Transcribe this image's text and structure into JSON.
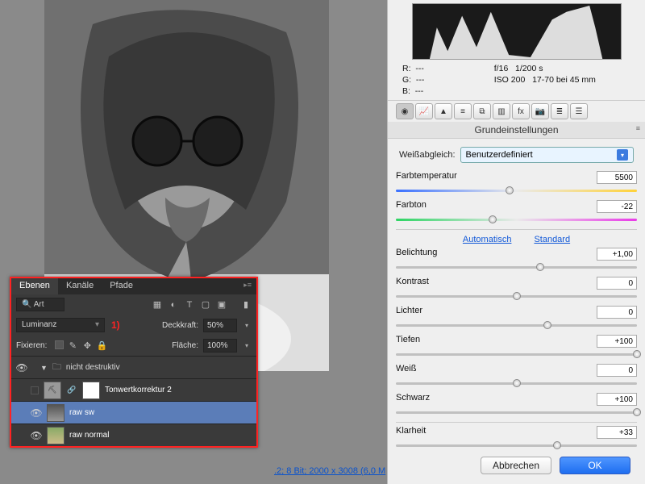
{
  "info_link": ".2; 8 Bit; 2000 x 3008 (6,0 M",
  "layers_panel": {
    "tabs": [
      "Ebenen",
      "Kanäle",
      "Pfade"
    ],
    "search_label": "Art",
    "icons": [
      "image",
      "circle",
      "T",
      "transform",
      "note"
    ],
    "blend_mode": "Luminanz",
    "marker": "1)",
    "opacity_label": "Deckkraft:",
    "opacity_value": "50%",
    "lock_label": "Fixieren:",
    "fill_label": "Fläche:",
    "fill_value": "100%",
    "group_name": "nicht destruktiv",
    "layers": [
      {
        "name": "Tonwertkorrektur 2",
        "type": "adjustment",
        "visible": false
      },
      {
        "name": "raw sw",
        "type": "image",
        "visible": true,
        "selected": true
      },
      {
        "name": "raw normal",
        "type": "image",
        "visible": true
      }
    ]
  },
  "metadata": {
    "rgb": {
      "R": "---",
      "G": "---",
      "B": "---"
    },
    "aperture": "f/16",
    "shutter": "1/200 s",
    "iso": "ISO 200",
    "lens": "17-70 bei 45 mm"
  },
  "section_title": "Grundeinstellungen",
  "wb": {
    "label": "Weißabgleich:",
    "value": "Benutzerdefiniert"
  },
  "sliders": {
    "temp": {
      "label": "Farbtemperatur",
      "value": "5500",
      "pos": 47
    },
    "tint": {
      "label": "Farbton",
      "value": "-22",
      "pos": 40
    },
    "auto": "Automatisch",
    "default": "Standard",
    "exposure": {
      "label": "Belichtung",
      "value": "+1,00",
      "pos": 60
    },
    "contrast": {
      "label": "Kontrast",
      "value": "0",
      "pos": 50
    },
    "highlights": {
      "label": "Lichter",
      "value": "0",
      "pos": 63
    },
    "shadows": {
      "label": "Tiefen",
      "value": "+100",
      "pos": 100
    },
    "whites": {
      "label": "Weiß",
      "value": "0",
      "pos": 50
    },
    "blacks": {
      "label": "Schwarz",
      "value": "+100",
      "pos": 100
    },
    "clarity": {
      "label": "Klarheit",
      "value": "+33",
      "pos": 67
    }
  },
  "buttons": {
    "cancel": "Abbrechen",
    "ok": "OK"
  }
}
